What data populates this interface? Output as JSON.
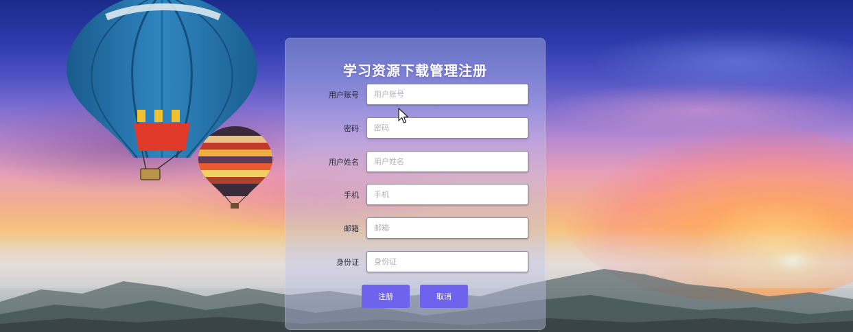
{
  "page": {
    "title": "学习资源下载管理注册"
  },
  "form": {
    "fields": [
      {
        "label": "用户账号",
        "placeholder": "用户账号"
      },
      {
        "label": "密码",
        "placeholder": "密码"
      },
      {
        "label": "用户姓名",
        "placeholder": "用户姓名"
      },
      {
        "label": "手机",
        "placeholder": "手机"
      },
      {
        "label": "邮箱",
        "placeholder": "邮箱"
      },
      {
        "label": "身份证",
        "placeholder": "身份证"
      }
    ],
    "register_label": "注册",
    "cancel_label": "取消"
  },
  "colors": {
    "button": "#6f63ee",
    "panel": "rgba(190,195,235,0.42)"
  },
  "icons": [
    "mouse-cursor-icon"
  ]
}
